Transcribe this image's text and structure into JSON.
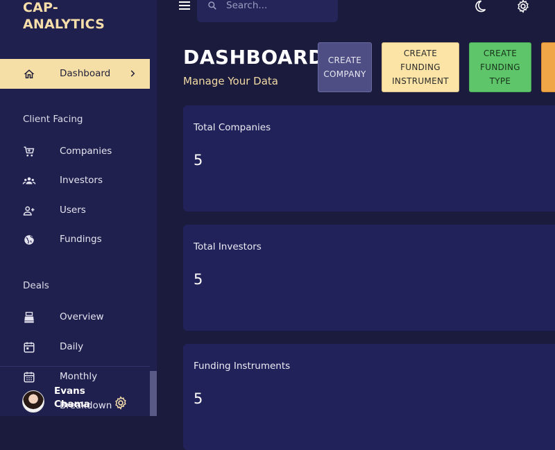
{
  "app": {
    "brand_line1": "CAP-",
    "brand_line2": "ANALYTICS"
  },
  "sidebar": {
    "active": {
      "label": "Dashboard",
      "icon": "home-icon"
    },
    "sections": [
      {
        "title": "Client Facing",
        "items": [
          {
            "label": "Companies",
            "icon": "cart-icon"
          },
          {
            "label": "Investors",
            "icon": "groups-icon"
          },
          {
            "label": "Users",
            "icon": "person-add-icon"
          },
          {
            "label": "Fundings",
            "icon": "globe-icon"
          }
        ]
      },
      {
        "title": "Deals",
        "items": [
          {
            "label": "Overview",
            "icon": "point-of-sale-icon"
          },
          {
            "label": "Daily",
            "icon": "calendar-day-icon"
          },
          {
            "label": "Monthly",
            "icon": "calendar-month-icon"
          },
          {
            "label": "Breakdown",
            "icon": "pie-chart-icon"
          }
        ]
      }
    ],
    "user": {
      "name": "Evans Chama"
    }
  },
  "topbar": {
    "search_placeholder": "Search..."
  },
  "header": {
    "title": "DASHBOARD",
    "subtitle": "Manage Your Data"
  },
  "actions": {
    "create_company": "CREATE\nCOMPANY",
    "create_funding_instrument": "CREATE\nFUNDING\nINSTRUMENT",
    "create_funding_type": "CREATE\nFUNDING\nTYPE"
  },
  "cards": [
    {
      "title": "Total Companies",
      "value": "5"
    },
    {
      "title": "Total Investors",
      "value": "5"
    },
    {
      "title": "Funding Instruments",
      "value": "5"
    }
  ],
  "colors": {
    "sidebar_bg": "#20204f",
    "page_bg": "#1b1b3d",
    "card_bg": "#22225a",
    "accent_gold": "#f6dfa6",
    "btn_green": "#5ec56a",
    "btn_orange": "#f0a647"
  }
}
